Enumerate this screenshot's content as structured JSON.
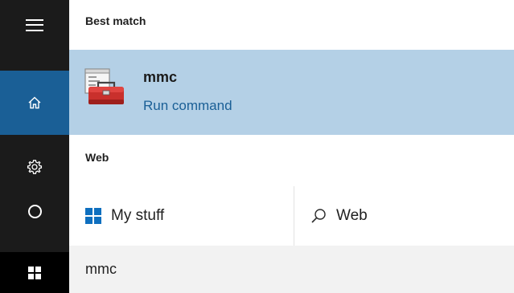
{
  "rail": {
    "items": [
      {
        "icon": "hamburger-menu-icon"
      },
      {
        "icon": "home-icon"
      },
      {
        "icon": "gear-icon"
      },
      {
        "icon": "cortana-icon"
      },
      {
        "icon": "windows-logo-icon"
      }
    ]
  },
  "best_match": {
    "heading": "Best match",
    "result": {
      "title": "mmc",
      "subtitle": "Run command",
      "icon": "toolbox-icon"
    }
  },
  "web_section": {
    "heading": "Web",
    "my_stuff_label": "My stuff",
    "web_label": "Web"
  },
  "search": {
    "query": "mmc"
  },
  "colors": {
    "rail_bg": "#1b1b1b",
    "rail_active": "#1a5f96",
    "result_highlight": "#b4d0e6",
    "link_blue": "#1a5f96",
    "query_bar_bg": "#f2f2f2"
  }
}
